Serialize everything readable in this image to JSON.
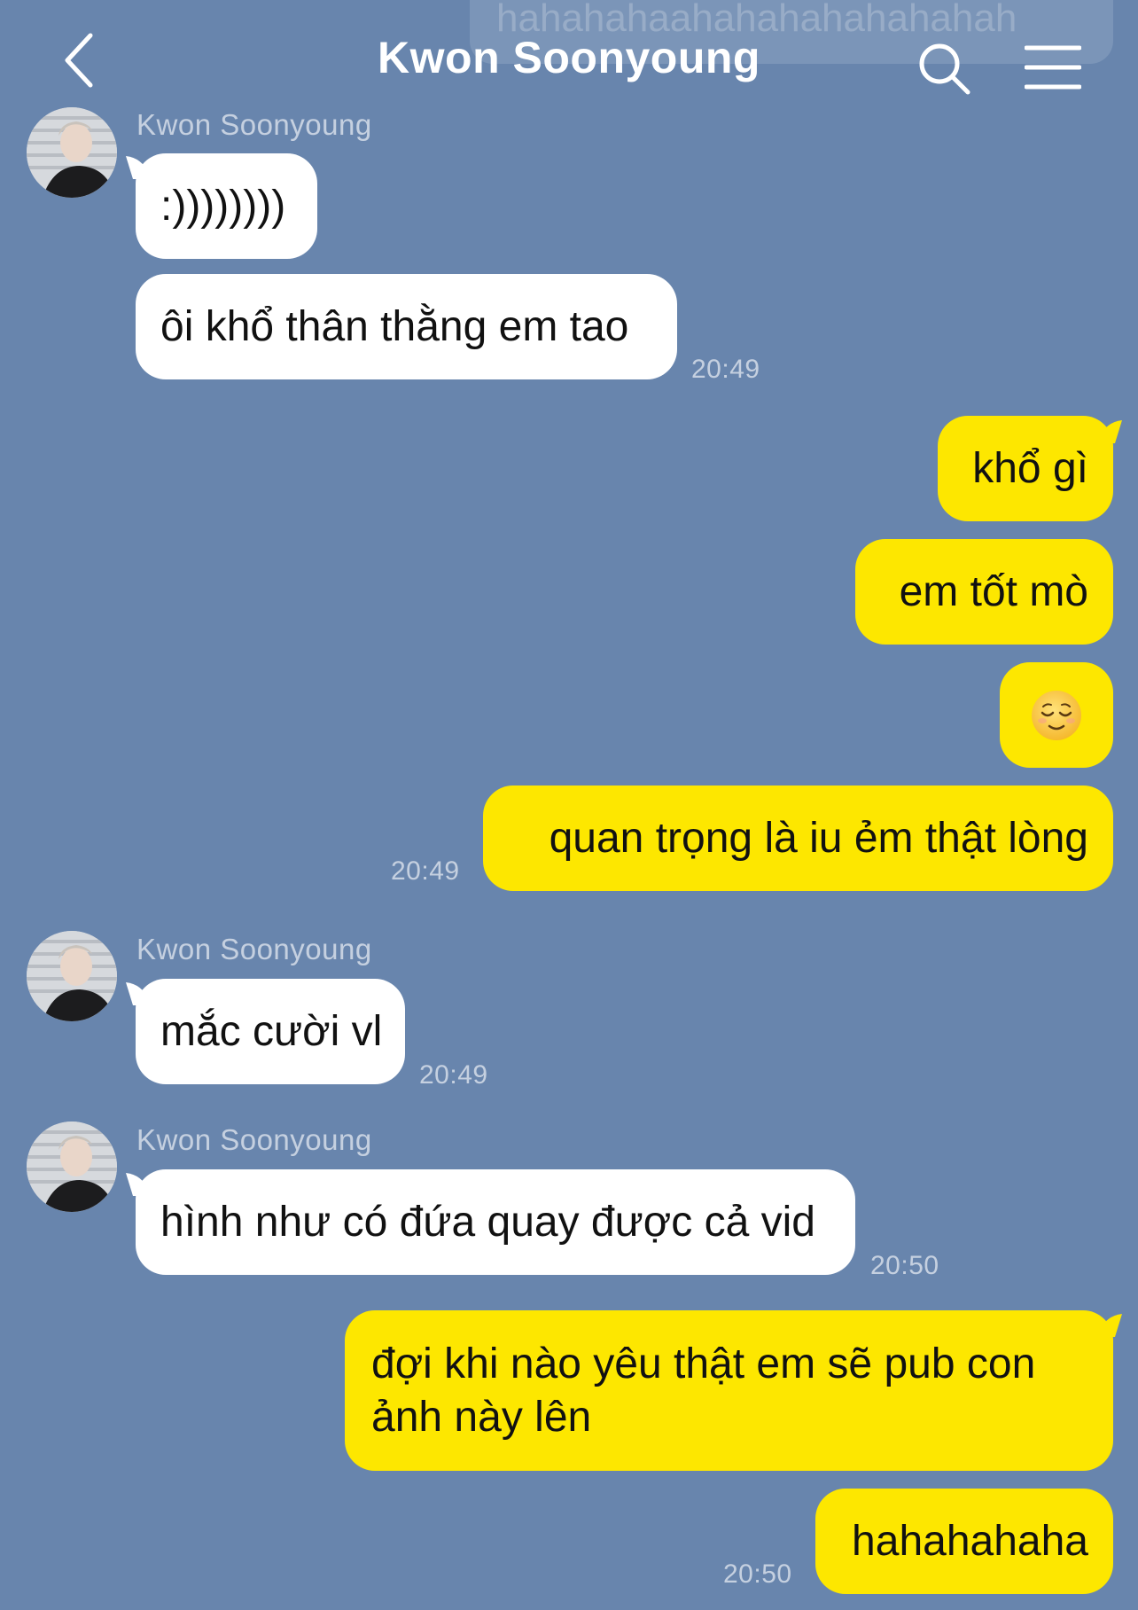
{
  "header": {
    "title": "Kwon Soonyoung",
    "back_icon": "chevron-left-icon",
    "search_icon": "search-icon",
    "menu_icon": "hamburger-menu-icon"
  },
  "previous_message_fragment": "hahahahaahahahahahahahah",
  "messages": [
    {
      "sender": "Kwon Soonyoung",
      "direction": "incoming",
      "text": ":))))))))"
    },
    {
      "direction": "incoming",
      "text": "ôi khổ thân thằng em tao",
      "time": "20:49"
    },
    {
      "direction": "outgoing",
      "text": "khổ gì"
    },
    {
      "direction": "outgoing",
      "text": "em tốt mò"
    },
    {
      "direction": "outgoing",
      "emoji": "relieved-face"
    },
    {
      "direction": "outgoing",
      "text": "quan trọng là iu ẻm thật lòng",
      "time": "20:49"
    },
    {
      "sender": "Kwon Soonyoung",
      "direction": "incoming",
      "text": "mắc cười vl",
      "time": "20:49"
    },
    {
      "sender": "Kwon Soonyoung",
      "direction": "incoming",
      "text": "hình như có đứa quay được cả vid",
      "time": "20:50"
    },
    {
      "direction": "outgoing",
      "text": "đợi khi nào yêu thật em sẽ pub con ảnh này lên"
    },
    {
      "direction": "outgoing",
      "text": "hahahahaha",
      "time": "20:50"
    }
  ],
  "colors": {
    "background": "#6885ad",
    "incoming_bubble": "#ffffff",
    "outgoing_bubble": "#fde700",
    "timestamp": "#c8d3e2"
  }
}
